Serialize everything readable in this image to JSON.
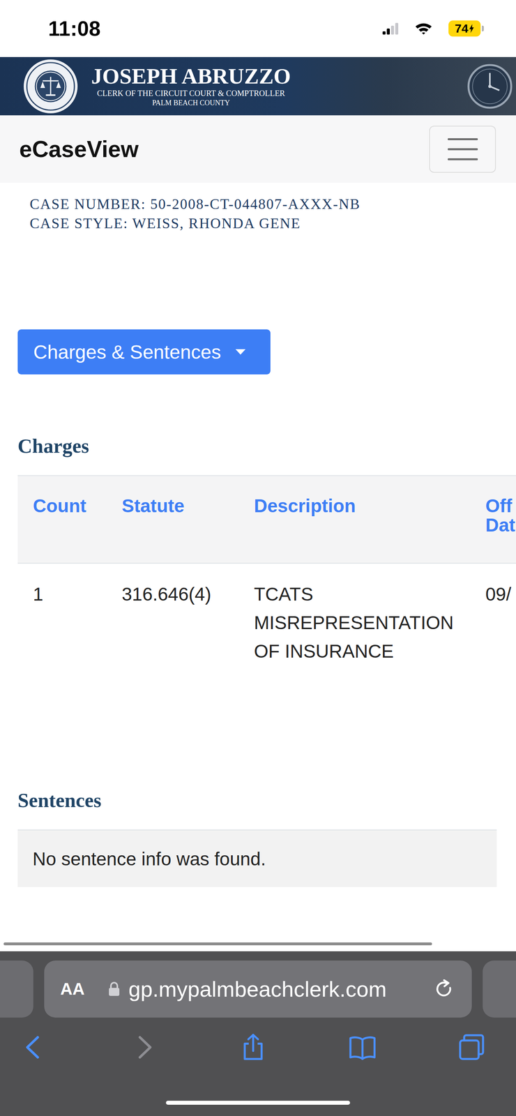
{
  "status_bar": {
    "time": "11:08",
    "signal": {
      "level": 0.5
    },
    "wifi": true,
    "battery": {
      "percent": "74",
      "charging": true
    }
  },
  "banner": {
    "name": "JOSEPH ABRUZZO",
    "subtitle": "CLERK OF THE CIRCUIT COURT & COMPTROLLER",
    "county": "PALM BEACH COUNTY"
  },
  "navbar": {
    "title": "eCaseView",
    "menu_expanded": false
  },
  "case": {
    "number_line": "CASE NUMBER: 50-2008-CT-044807-AXXX-NB",
    "style_line": "CASE STYLE: WEISS, RHONDA GENE"
  },
  "section_dropdown": {
    "label": "Charges & Sentences",
    "expanded": false
  },
  "charges": {
    "title": "Charges",
    "columns": [
      "Count",
      "Statute",
      "Description",
      "Off Dat"
    ],
    "rows": [
      {
        "count": "1",
        "statute": "316.646(4)",
        "description": "TCATS MISREPRESENTATION OF INSURANCE",
        "offense_date": "09/"
      }
    ]
  },
  "sentences": {
    "title": "Sentences",
    "empty_message": "No sentence info was found."
  },
  "page_scrollbar": {
    "level": 0.83
  },
  "browser": {
    "reader_button": "AA",
    "secure": true,
    "url": "gp.mypalmbeachclerk.com",
    "toolbar": [
      {
        "kind": "back",
        "disabled": false
      },
      {
        "kind": "forward",
        "disabled": true
      },
      {
        "kind": "share",
        "disabled": false
      },
      {
        "kind": "bookmarks",
        "disabled": false
      },
      {
        "kind": "tabs",
        "disabled": false
      }
    ]
  }
}
